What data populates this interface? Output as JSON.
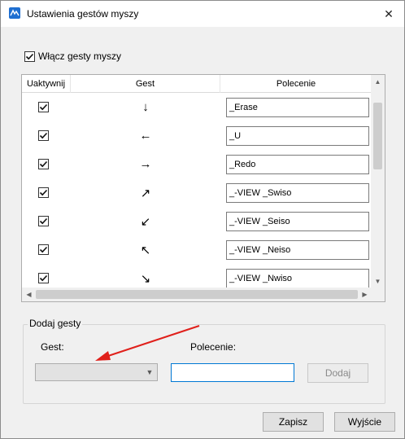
{
  "window": {
    "title": "Ustawienia gestów myszy",
    "close_glyph": "✕"
  },
  "enable": {
    "label": "Włącz gesty myszy",
    "checked": true
  },
  "grid": {
    "headers": [
      "Uaktywnij",
      "Gest",
      "Polecenie"
    ],
    "rows": [
      {
        "active": true,
        "gesture": "↓",
        "gesture_icon": "arrow-down-icon",
        "command": "_Erase"
      },
      {
        "active": true,
        "gesture": "←",
        "gesture_icon": "arrow-left-icon",
        "command": "_U"
      },
      {
        "active": true,
        "gesture": "→",
        "gesture_icon": "arrow-right-icon",
        "command": "_Redo"
      },
      {
        "active": true,
        "gesture": "↗",
        "gesture_icon": "arrow-up-right-icon",
        "command": "_-VIEW _Swiso"
      },
      {
        "active": true,
        "gesture": "↙",
        "gesture_icon": "arrow-down-left-icon",
        "command": "_-VIEW _Seiso"
      },
      {
        "active": true,
        "gesture": "↖",
        "gesture_icon": "arrow-up-left-icon",
        "command": "_-VIEW _Neiso"
      },
      {
        "active": true,
        "gesture": "↘",
        "gesture_icon": "arrow-down-right-icon",
        "command": "_-VIEW _Nwiso"
      }
    ]
  },
  "add_group": {
    "legend": "Dodaj gesty",
    "gest_label": "Gest:",
    "polecenie_label": "Polecenie:",
    "gest_value": "",
    "polecenie_value": "",
    "add_button": "Dodaj"
  },
  "buttons": {
    "save": "Zapisz",
    "exit": "Wyjście"
  },
  "colors": {
    "accent": "#0078d4",
    "annotation_arrow": "#e0201b",
    "window_bg": "#f0f0f0"
  }
}
